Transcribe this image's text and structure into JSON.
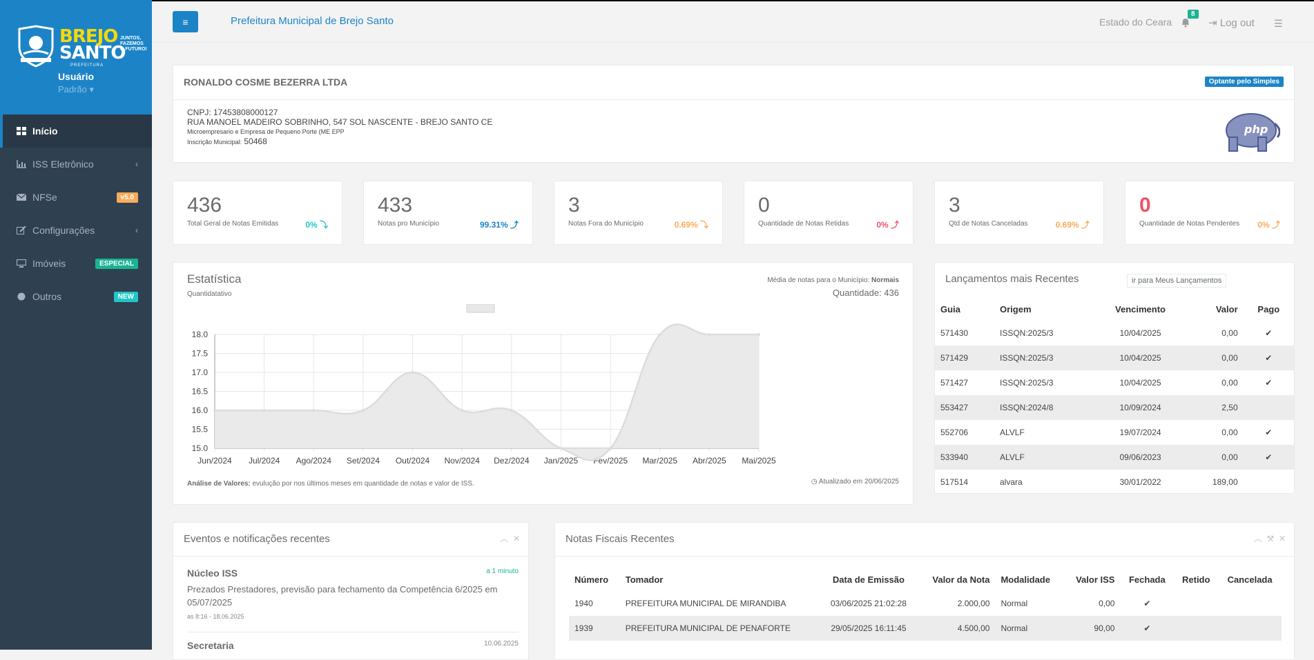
{
  "sidebar": {
    "logo": {
      "brand1": "BREJO",
      "brand2": "SANTO",
      "tagline1": "JUNTOS,",
      "tagline2": "FAZEMOS",
      "tagline3": "O FUTURO!",
      "pref": "PREFEITURA"
    },
    "user_name": "Usuário",
    "user_role": "Padrão ▾",
    "items": [
      {
        "label": "Início",
        "icon": "grid-icon"
      },
      {
        "label": "ISS Eletrônico",
        "icon": "bar-chart-icon",
        "chevron": "‹"
      },
      {
        "label": "NFSe",
        "icon": "envelope-icon",
        "badge": "v5.0"
      },
      {
        "label": "Configurações",
        "icon": "edit-icon",
        "chevron": "‹"
      },
      {
        "label": "Imóveis",
        "icon": "monitor-icon",
        "badge": "ESPECIAL"
      },
      {
        "label": "Outros",
        "icon": "globe-icon",
        "badge": "NEW"
      }
    ]
  },
  "topbar": {
    "menu_icon": "≡",
    "title": "Prefeitura Municipal de Brejo Santo",
    "state": "Estado do Ceara",
    "bell_count": "8",
    "logout": "Log out",
    "settings_icon": "☰"
  },
  "company": {
    "name": "RONALDO COSME BEZERRA LTDA",
    "optante": "Optante pelo Simples",
    "cnpj": "CNPJ: 17453808000127",
    "address": "RUA MANOEL MADEIRO SOBRINHO, 547 SOL NASCENTE - BREJO SANTO CE",
    "porte": "Microempresario e Empresa de Pequeno Porte (ME EPP",
    "im_label": "Inscrição Municipal:",
    "im_value": "50468"
  },
  "stats": [
    {
      "num": "436",
      "label": "Total Geral de Notas Emitidas",
      "pct": "0% ⤵",
      "color": "#23c6c8"
    },
    {
      "num": "433",
      "label": "Notas pro Município",
      "pct": "99.31% ⤴",
      "color": "#1c84c6"
    },
    {
      "num": "3",
      "label": "Notas Fora do Município",
      "pct": "0.69% ⤵",
      "color": "#f8ac59"
    },
    {
      "num": "0",
      "label": "Quantidade de Notas Retidas",
      "pct": "0% ⤴",
      "color": "#ed5565"
    },
    {
      "num": "3",
      "label": "Qtd de Notas Canceladas",
      "pct": "0.69% ⤴",
      "color": "#f8ac59"
    },
    {
      "num": "0",
      "label": "Quantidade de Notas Pendentes",
      "pct": "0% ⤴",
      "color": "#f8ac59"
    }
  ],
  "estatistica": {
    "title": "Estatística",
    "subtitle": "Quantidatativo",
    "media_label": "Média de notas para o Município:",
    "media_value": "Normais",
    "qtd": "Quantidade: 436",
    "foot_bold": "Análise de Valores:",
    "foot_text": " evulução por nos últimos meses em quantidade de notas e valor de ISS.",
    "updated": "◷ Atualizado em 20/06/2025"
  },
  "chart_data": {
    "type": "area",
    "categories": [
      "Jun/2024",
      "Jul/2024",
      "Ago/2024",
      "Set/2024",
      "Out/2024",
      "Nov/2024",
      "Dez/2024",
      "Jan/2025",
      "Fev/2025",
      "Mar/2025",
      "Abr/2025",
      "Mai/2025"
    ],
    "series": [
      {
        "values": [
          16,
          16,
          16,
          16,
          17,
          16,
          16,
          15,
          15,
          18,
          18,
          18
        ]
      }
    ],
    "yticks": [
      "18.0",
      "17.5",
      "17.0",
      "16.5",
      "16.0",
      "15.5",
      "15.0"
    ],
    "ylim": [
      15,
      18
    ],
    "grid": true,
    "fill": "#e8e8e8",
    "stroke": "#dcdcdc"
  },
  "lancamentos": {
    "title": "Lançamentos mais Recentes",
    "button": "ir para Meus Lançamentos",
    "headers": [
      "Guia",
      "Origem",
      "Vencimento",
      "Valor",
      "Pago"
    ],
    "rows": [
      [
        "571430",
        "ISSQN:2025/3",
        "10/04/2025",
        "0,00",
        "✔"
      ],
      [
        "571429",
        "ISSQN:2025/3",
        "10/04/2025",
        "0,00",
        "✔"
      ],
      [
        "571427",
        "ISSQN:2025/3",
        "10/04/2025",
        "0,00",
        "✔"
      ],
      [
        "553427",
        "ISSQN:2024/8",
        "10/09/2024",
        "2,50",
        ""
      ],
      [
        "552706",
        "ALVLF",
        "19/07/2024",
        "0,00",
        "✔"
      ],
      [
        "533940",
        "ALVLF",
        "09/06/2023",
        "0,00",
        "✔"
      ],
      [
        "517514",
        "alvara",
        "30/01/2022",
        "189,00",
        ""
      ]
    ]
  },
  "eventos": {
    "title": "Eventos e notificações recentes",
    "items": [
      {
        "title": "Núcleo ISS",
        "time": "a 1 minuto",
        "text": "Prezados Prestadores, previsão para fechamento da Competência 6/2025 em 05/07/2025",
        "date": "as 8:16 - 18.06.2025"
      },
      {
        "title": "Secretaria",
        "time": "10.06.2025"
      }
    ]
  },
  "notas": {
    "title": "Notas Fiscais Recentes",
    "headers": [
      "Número",
      "Tomador",
      "Data de Emissão",
      "Valor da Nota",
      "Modalidade",
      "Valor ISS",
      "Fechada",
      "Retido",
      "Cancelada"
    ],
    "rows": [
      [
        "1940",
        "PREFEITURA MUNICIPAL DE MIRANDIBA",
        "03/06/2025 21:02:28",
        "2.000,00",
        "Normal",
        "0,00",
        "✔",
        "",
        ""
      ],
      [
        "1939",
        "PREFEITURA MUNICIPAL DE PENAFORTE",
        "29/05/2025 16:11:45",
        "4.500,00",
        "Normal",
        "90,00",
        "✔",
        "",
        ""
      ]
    ]
  }
}
